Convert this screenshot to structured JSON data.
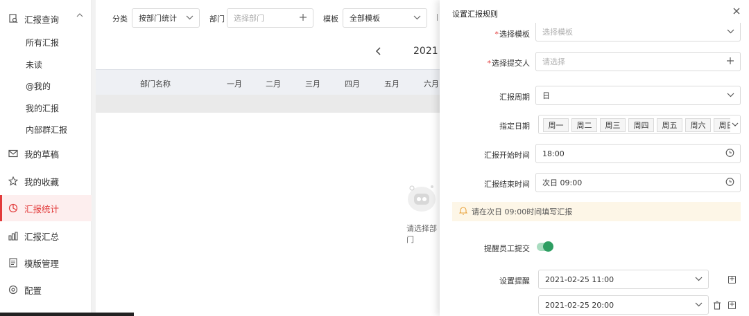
{
  "sidebar": {
    "query": {
      "label": "汇报查询",
      "icon": "search-doc-icon"
    },
    "sub_items": [
      "所有汇报",
      "未读",
      "@我的",
      "我的汇报",
      "内部群汇报"
    ],
    "items": [
      {
        "label": "我的草稿",
        "icon": "mail-icon"
      },
      {
        "label": "我的收藏",
        "icon": "star-icon"
      },
      {
        "label": "汇报统计",
        "icon": "pie-chart-icon"
      },
      {
        "label": "汇报汇总",
        "icon": "bar-chart-icon"
      },
      {
        "label": "模版管理",
        "icon": "document-icon"
      },
      {
        "label": "配置",
        "icon": "gear-icon"
      }
    ],
    "active_color": "#e23b3b"
  },
  "filters": {
    "category_label": "分类",
    "category_value": "按部门统计",
    "dept_label": "部门",
    "dept_placeholder": "选择部门",
    "template_label": "模板",
    "template_value": "全部模板"
  },
  "year": "2021",
  "table": {
    "headers": [
      "部门名称",
      "一月",
      "二月",
      "三月",
      "四月",
      "五月",
      "六月"
    ]
  },
  "empty_text": "请选择部门",
  "drawer": {
    "title": "设置汇报规则",
    "template_label": "选择模板",
    "template_placeholder": "选择模板",
    "submitter_label": "选择提交人",
    "submitter_placeholder": "请选择",
    "period_label": "汇报周期",
    "period_value": "日",
    "date_label": "指定日期",
    "days": [
      "周一",
      "周二",
      "周三",
      "周四",
      "周五",
      "周六",
      "周日"
    ],
    "start_label": "汇报开始时间",
    "start_value": "18:00",
    "end_label": "汇报结束时间",
    "end_value": "次日 09:00",
    "tip": "请在次日 09:00时间填写汇报",
    "remind_label": "提醒员工提交",
    "remind_on": true,
    "reminder_label": "设置提醒",
    "reminders": [
      "2021-02-25 11:00",
      "2021-02-25 20:00"
    ],
    "accent_color": "#2e9e62"
  }
}
